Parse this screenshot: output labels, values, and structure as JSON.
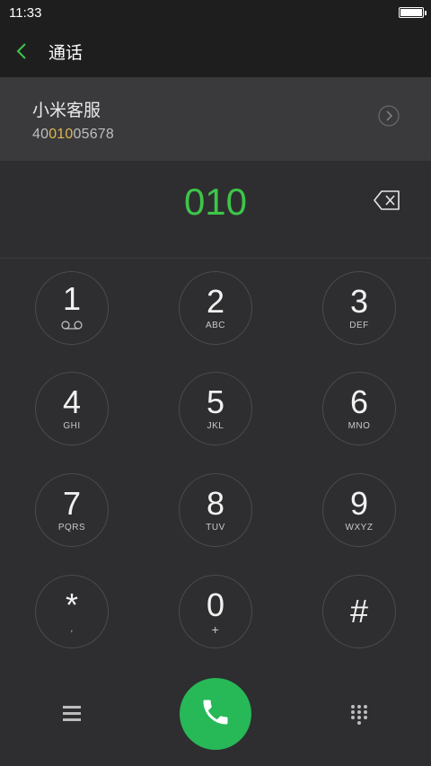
{
  "status": {
    "time": "11:33"
  },
  "header": {
    "title": "通话"
  },
  "suggestion": {
    "name": "小米客服",
    "number_prefix": "40",
    "number_match": "010",
    "number_suffix": "05678"
  },
  "dial": {
    "typed": "010"
  },
  "keys": [
    {
      "digit": "1",
      "letters": ""
    },
    {
      "digit": "2",
      "letters": "ABC"
    },
    {
      "digit": "3",
      "letters": "DEF"
    },
    {
      "digit": "4",
      "letters": "GHI"
    },
    {
      "digit": "5",
      "letters": "JKL"
    },
    {
      "digit": "6",
      "letters": "MNO"
    },
    {
      "digit": "7",
      "letters": "PQRS"
    },
    {
      "digit": "8",
      "letters": "TUV"
    },
    {
      "digit": "9",
      "letters": "WXYZ"
    },
    {
      "digit": "*",
      "letters": ","
    },
    {
      "digit": "0",
      "letters": "+"
    },
    {
      "digit": "#",
      "letters": ""
    }
  ],
  "colors": {
    "accent": "#3ec54a",
    "highlight": "#e0b84a",
    "call": "#27b858",
    "background": "#2e2e30"
  },
  "icons": [
    "back-icon",
    "detail-arrow-icon",
    "backspace-icon",
    "voicemail-icon",
    "menu-icon",
    "phone-icon",
    "dialpad-icon"
  ]
}
